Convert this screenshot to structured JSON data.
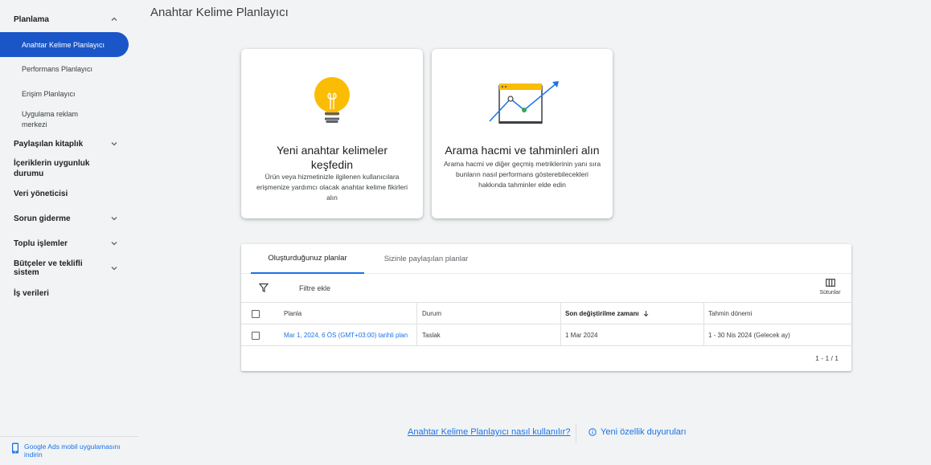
{
  "sidebar": {
    "items": [
      {
        "label": "Planlama",
        "chevron": "up"
      },
      {
        "label": "Anahtar Kelime Planlayıcı"
      },
      {
        "label": "Performans Planlayıcı"
      },
      {
        "label": "Erişim Planlayıcı"
      },
      {
        "label": "Uygulama reklam merkezi"
      },
      {
        "label": "Paylaşılan kitaplık",
        "chevron": "down"
      },
      {
        "label": "İçeriklerin uygunluk durumu"
      },
      {
        "label": "Veri yöneticisi"
      },
      {
        "label": "Sorun giderme",
        "chevron": "down"
      },
      {
        "label": "Toplu işlemler",
        "chevron": "down"
      },
      {
        "label": "Bütçeler ve teklifli sistem",
        "chevron": "down"
      },
      {
        "label": "İş verileri"
      }
    ],
    "footer_label": "Google Ads mobil uygulamasını indirin"
  },
  "page": {
    "title": "Anahtar Kelime Planlayıcı"
  },
  "cards": {
    "discover": {
      "title": "Yeni anahtar kelimeler keşfedin",
      "desc": "Ürün veya hizmetinizle ilgilenen kullanıcılara erişmenize yardımcı olacak anahtar kelime fikirleri alın",
      "icon": "lightbulb-icon"
    },
    "forecast": {
      "title": "Arama hacmi ve tahminleri alın",
      "desc": "Arama hacmi ve diğer geçmiş metriklerinin yanı sıra bunların nasıl performans gösterebilecekleri hakkında tahminler elde edin",
      "icon": "chart-trend-icon"
    }
  },
  "plans": {
    "tabs": [
      "Oluşturduğunuz planlar",
      "Sizinle paylaşılan planlar"
    ],
    "active_tab": 0,
    "filter_label": "Filtre ekle",
    "columns_label": "Sütunlar",
    "headers": [
      "Planla",
      "Durum",
      "Son değiştirilme zamanı",
      "Tahmin dönemi"
    ],
    "rows": [
      {
        "name": "Mar 1, 2024, 6 ÖS (GMT+03:00) tarihli plan",
        "status": "Taslak",
        "modified": "1 Mar 2024",
        "period": "1 - 30 Nis 2024 (Gelecek ay)"
      }
    ],
    "pagination": "1 - 1 / 1"
  },
  "footer": {
    "help_link": "Anahtar Kelime Planlayıcı nasıl kullanılır?",
    "news_link": "Yeni özellik duyuruları"
  },
  "colors": {
    "accent": "#1a73e8",
    "active_nav": "#1a56c7",
    "bulb": "#fbbc04",
    "green": "#34a853"
  }
}
